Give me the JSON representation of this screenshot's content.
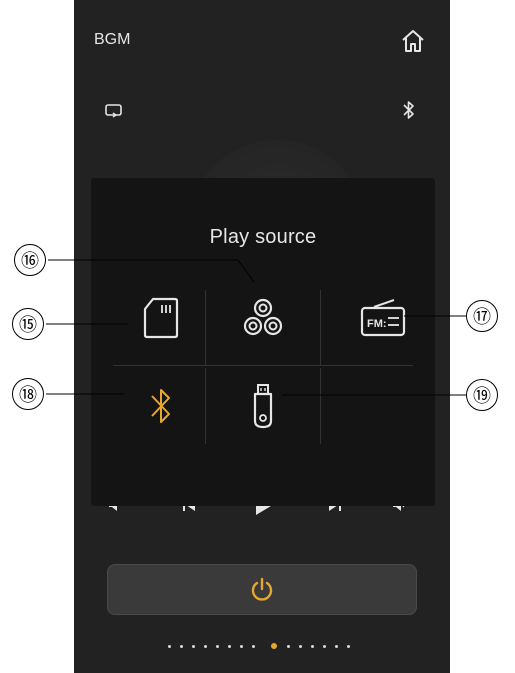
{
  "header": {
    "title": "BGM"
  },
  "icons": {
    "home": "home-icon",
    "repeat": "repeat-icon",
    "bluetooth": "bluetooth-icon"
  },
  "play_source": {
    "title": "Play source",
    "sources": [
      {
        "name": "sd-card",
        "icon": "sd-card-icon"
      },
      {
        "name": "multi-disc",
        "icon": "multi-disc-icon"
      },
      {
        "name": "fm-radio",
        "icon": "fm-radio-icon",
        "text": "FM:"
      },
      {
        "name": "bluetooth",
        "icon": "bluetooth-icon",
        "selected": true
      },
      {
        "name": "usb",
        "icon": "usb-drive-icon"
      }
    ]
  },
  "callouts": [
    "⑮",
    "⑯",
    "⑰",
    "⑱",
    "⑲"
  ],
  "colors": {
    "accent": "#e6a72e",
    "background": "#222222",
    "panel": "#141414"
  },
  "pager": {
    "total": 13,
    "active_index": 8
  }
}
